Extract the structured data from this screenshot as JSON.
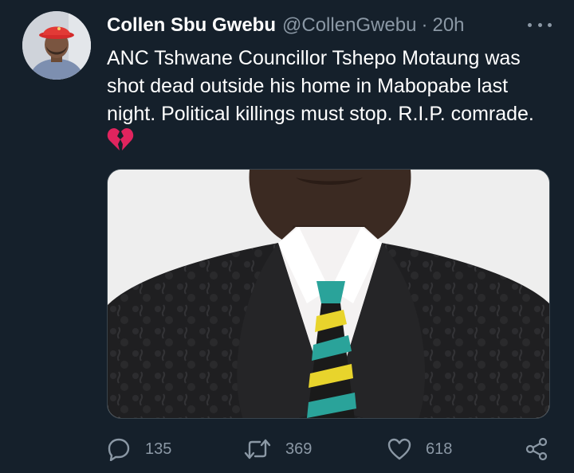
{
  "user": {
    "display_name": "Collen Sbu Gwebu",
    "handle": "@CollenGwebu",
    "separator": "·",
    "timestamp": "20h"
  },
  "tweet": {
    "lines": [
      "ANC Tshwane Councillor Tshepo Motaung was",
      "shot dead outside his home in Mabopabe last",
      "night. Political killings must stop. R.I.P. comrade."
    ],
    "emoji": "broken-heart-icon"
  },
  "actions": {
    "reply_count": "135",
    "retweet_count": "369",
    "like_count": "618"
  },
  "icons": {
    "more": "more-options-icon",
    "reply": "reply-icon",
    "retweet": "retweet-icon",
    "like": "like-icon",
    "share": "share-icon"
  },
  "colors": {
    "background": "#15202b",
    "primary_text": "#ffffff",
    "secondary_text": "#8b98a5",
    "border": "#38444d"
  }
}
